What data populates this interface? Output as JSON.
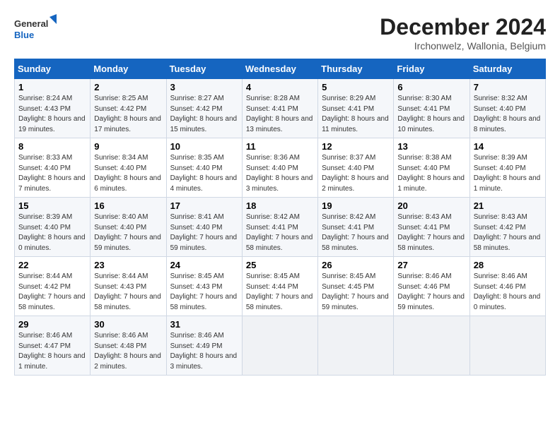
{
  "header": {
    "logo_general": "General",
    "logo_blue": "Blue",
    "month_title": "December 2024",
    "location": "Irchonwelz, Wallonia, Belgium"
  },
  "weekdays": [
    "Sunday",
    "Monday",
    "Tuesday",
    "Wednesday",
    "Thursday",
    "Friday",
    "Saturday"
  ],
  "weeks": [
    [
      {
        "day": "1",
        "sunrise": "8:24 AM",
        "sunset": "4:43 PM",
        "daylight": "8 hours and 19 minutes."
      },
      {
        "day": "2",
        "sunrise": "8:25 AM",
        "sunset": "4:42 PM",
        "daylight": "8 hours and 17 minutes."
      },
      {
        "day": "3",
        "sunrise": "8:27 AM",
        "sunset": "4:42 PM",
        "daylight": "8 hours and 15 minutes."
      },
      {
        "day": "4",
        "sunrise": "8:28 AM",
        "sunset": "4:41 PM",
        "daylight": "8 hours and 13 minutes."
      },
      {
        "day": "5",
        "sunrise": "8:29 AM",
        "sunset": "4:41 PM",
        "daylight": "8 hours and 11 minutes."
      },
      {
        "day": "6",
        "sunrise": "8:30 AM",
        "sunset": "4:41 PM",
        "daylight": "8 hours and 10 minutes."
      },
      {
        "day": "7",
        "sunrise": "8:32 AM",
        "sunset": "4:40 PM",
        "daylight": "8 hours and 8 minutes."
      }
    ],
    [
      {
        "day": "8",
        "sunrise": "8:33 AM",
        "sunset": "4:40 PM",
        "daylight": "8 hours and 7 minutes."
      },
      {
        "day": "9",
        "sunrise": "8:34 AM",
        "sunset": "4:40 PM",
        "daylight": "8 hours and 6 minutes."
      },
      {
        "day": "10",
        "sunrise": "8:35 AM",
        "sunset": "4:40 PM",
        "daylight": "8 hours and 4 minutes."
      },
      {
        "day": "11",
        "sunrise": "8:36 AM",
        "sunset": "4:40 PM",
        "daylight": "8 hours and 3 minutes."
      },
      {
        "day": "12",
        "sunrise": "8:37 AM",
        "sunset": "4:40 PM",
        "daylight": "8 hours and 2 minutes."
      },
      {
        "day": "13",
        "sunrise": "8:38 AM",
        "sunset": "4:40 PM",
        "daylight": "8 hours and 1 minute."
      },
      {
        "day": "14",
        "sunrise": "8:39 AM",
        "sunset": "4:40 PM",
        "daylight": "8 hours and 1 minute."
      }
    ],
    [
      {
        "day": "15",
        "sunrise": "8:39 AM",
        "sunset": "4:40 PM",
        "daylight": "8 hours and 0 minutes."
      },
      {
        "day": "16",
        "sunrise": "8:40 AM",
        "sunset": "4:40 PM",
        "daylight": "7 hours and 59 minutes."
      },
      {
        "day": "17",
        "sunrise": "8:41 AM",
        "sunset": "4:40 PM",
        "daylight": "7 hours and 59 minutes."
      },
      {
        "day": "18",
        "sunrise": "8:42 AM",
        "sunset": "4:41 PM",
        "daylight": "7 hours and 58 minutes."
      },
      {
        "day": "19",
        "sunrise": "8:42 AM",
        "sunset": "4:41 PM",
        "daylight": "7 hours and 58 minutes."
      },
      {
        "day": "20",
        "sunrise": "8:43 AM",
        "sunset": "4:41 PM",
        "daylight": "7 hours and 58 minutes."
      },
      {
        "day": "21",
        "sunrise": "8:43 AM",
        "sunset": "4:42 PM",
        "daylight": "7 hours and 58 minutes."
      }
    ],
    [
      {
        "day": "22",
        "sunrise": "8:44 AM",
        "sunset": "4:42 PM",
        "daylight": "7 hours and 58 minutes."
      },
      {
        "day": "23",
        "sunrise": "8:44 AM",
        "sunset": "4:43 PM",
        "daylight": "7 hours and 58 minutes."
      },
      {
        "day": "24",
        "sunrise": "8:45 AM",
        "sunset": "4:43 PM",
        "daylight": "7 hours and 58 minutes."
      },
      {
        "day": "25",
        "sunrise": "8:45 AM",
        "sunset": "4:44 PM",
        "daylight": "7 hours and 58 minutes."
      },
      {
        "day": "26",
        "sunrise": "8:45 AM",
        "sunset": "4:45 PM",
        "daylight": "7 hours and 59 minutes."
      },
      {
        "day": "27",
        "sunrise": "8:46 AM",
        "sunset": "4:46 PM",
        "daylight": "7 hours and 59 minutes."
      },
      {
        "day": "28",
        "sunrise": "8:46 AM",
        "sunset": "4:46 PM",
        "daylight": "8 hours and 0 minutes."
      }
    ],
    [
      {
        "day": "29",
        "sunrise": "8:46 AM",
        "sunset": "4:47 PM",
        "daylight": "8 hours and 1 minute."
      },
      {
        "day": "30",
        "sunrise": "8:46 AM",
        "sunset": "4:48 PM",
        "daylight": "8 hours and 2 minutes."
      },
      {
        "day": "31",
        "sunrise": "8:46 AM",
        "sunset": "4:49 PM",
        "daylight": "8 hours and 3 minutes."
      },
      null,
      null,
      null,
      null
    ]
  ]
}
